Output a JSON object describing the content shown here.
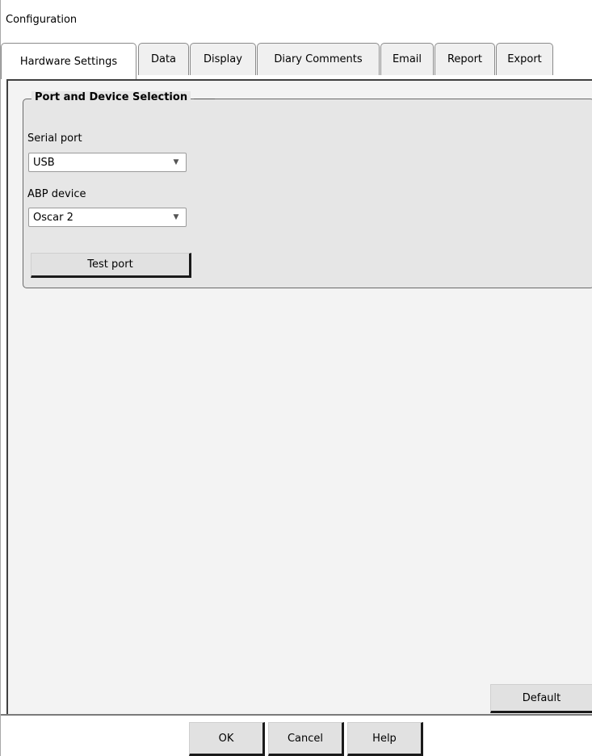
{
  "window": {
    "title": "Configuration"
  },
  "tabs": [
    {
      "label": "Hardware Settings",
      "active": true
    },
    {
      "label": "Data"
    },
    {
      "label": "Display"
    },
    {
      "label": "Diary Comments"
    },
    {
      "label": "Email"
    },
    {
      "label": "Report"
    },
    {
      "label": "Export"
    }
  ],
  "group": {
    "title": "Port and Device Selection",
    "serial_port": {
      "label": "Serial port",
      "value": "USB"
    },
    "abp_device": {
      "label": "ABP device",
      "value": "Oscar 2"
    },
    "test_button": "Test port"
  },
  "default_button": "Default",
  "footer": {
    "ok": "OK",
    "cancel": "Cancel",
    "help": "Help"
  },
  "icons": {
    "dropdown": "chevron-down-icon"
  }
}
